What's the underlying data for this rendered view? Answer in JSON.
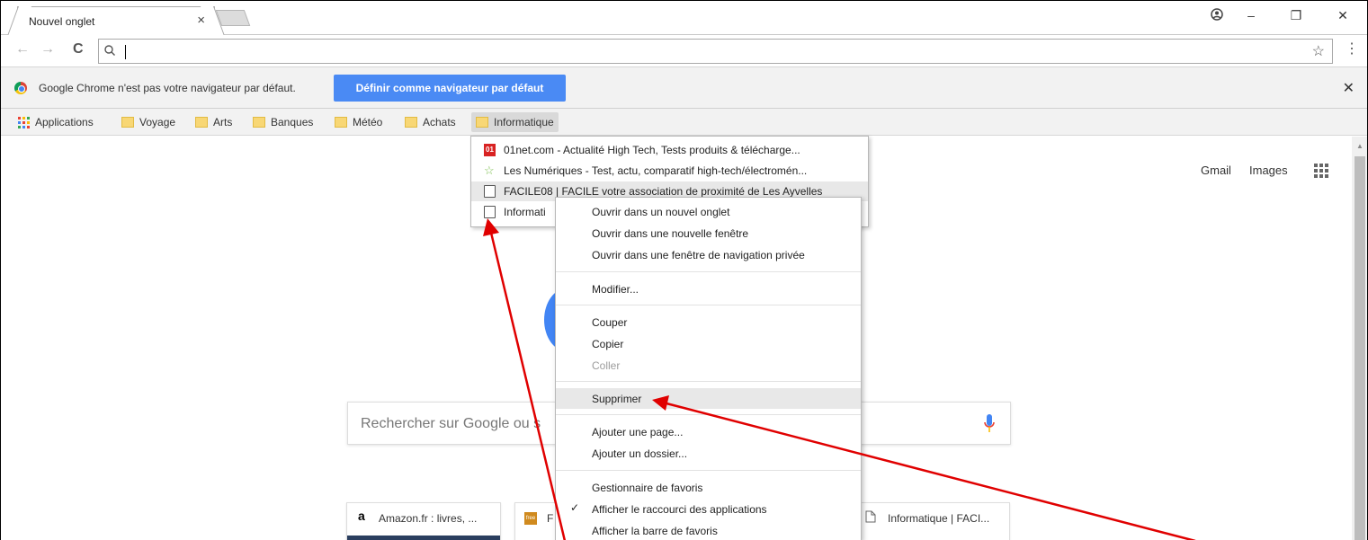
{
  "browser": {
    "tab_title": "Nouvel onglet",
    "tab_close": "×",
    "window_controls": {
      "account": "account-icon",
      "minimize": "–",
      "restore": "❐",
      "close": "✕"
    },
    "omnibox_value": "",
    "star": "☆",
    "menu": "⋮"
  },
  "infobar": {
    "message": "Google Chrome n'est pas votre navigateur par défaut.",
    "button": "Définir comme navigateur par défaut",
    "close": "✕"
  },
  "bookmarks_bar": {
    "apps_label": "Applications",
    "folders": [
      "Voyage",
      "Arts",
      "Banques",
      "Météo",
      "Achats",
      "Informatique"
    ]
  },
  "page": {
    "gmail": "Gmail",
    "images": "Images",
    "search_placeholder": "Rechercher sur Google ou s",
    "tiles": [
      "Amazon.fr : livres, ...",
      "F",
      "Informatique | FACI..."
    ],
    "tile_logos": [
      "a",
      "free"
    ]
  },
  "folder_menu": {
    "items": [
      "01net.com - Actualité High Tech, Tests produits & télécharge...",
      "Les Numériques - Test, actu, comparatif high-tech/électromén...",
      "FACILE08 | FACILE votre association de proximité de Les Ayvelles",
      "Informati"
    ],
    "net_logo": "01"
  },
  "context_menu": {
    "items": [
      "Ouvrir dans un nouvel onglet",
      "Ouvrir dans une nouvelle fenêtre",
      "Ouvrir dans une fenêtre de navigation privée",
      "Modifier...",
      "Couper",
      "Copier",
      "Coller",
      "Supprimer",
      "Ajouter une page...",
      "Ajouter un dossier...",
      "Gestionnaire de favoris",
      "Afficher le raccourci des applications",
      "Afficher la barre de favoris"
    ],
    "disabled": [
      "Coller"
    ],
    "selected": "Supprimer",
    "checked": "Afficher le raccourci des applications"
  },
  "colors": {
    "accent_button": "#4a8af4",
    "annotation_arrow": "#e00000",
    "google_blue": "#4285f4"
  }
}
